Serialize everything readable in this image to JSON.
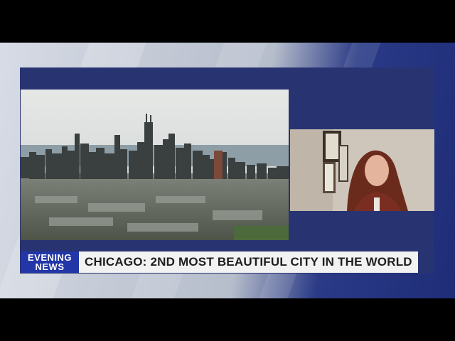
{
  "lower_third": {
    "bug_line1": "EVENING",
    "bug_line2": "NEWS",
    "headline": "CHICAGO: 2ND MOST BEAUTIFUL CITY IN THE WORLD"
  },
  "colors": {
    "panel": "#283372",
    "bug": "#2236a8",
    "headline_bg": "#f2f2f2"
  },
  "icons": [
    "skyline-video",
    "guest-video"
  ]
}
